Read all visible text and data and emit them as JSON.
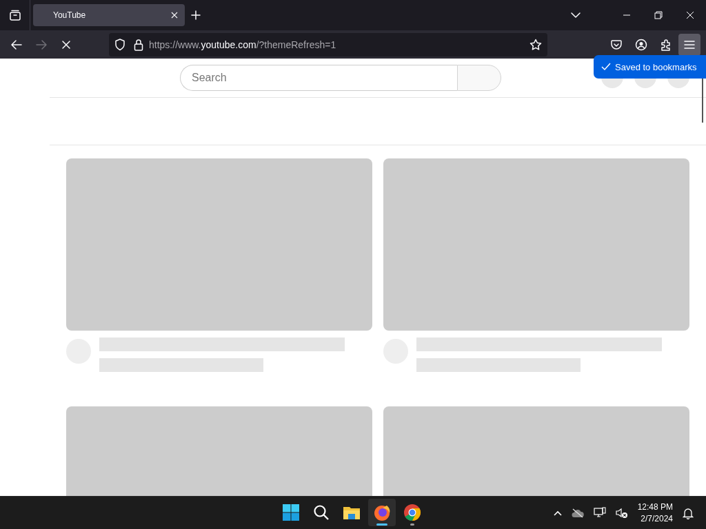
{
  "browser": {
    "tabs": [
      {
        "title": "YouTube",
        "selected": true
      }
    ],
    "loading": true,
    "forward_enabled": false,
    "menu_open": true,
    "address": {
      "prefix": "https://www.",
      "domain": "youtube.com",
      "path": "/?themeRefresh=1"
    }
  },
  "toast": {
    "text": "Saved to bookmarks"
  },
  "page": {
    "search": {
      "placeholder": "Search"
    },
    "header_buttons": [
      {
        "kind": "skeleton"
      },
      {
        "kind": "skeleton"
      },
      {
        "kind": "skeleton"
      }
    ],
    "videos": [
      {
        "kind": "skeleton"
      },
      {
        "kind": "skeleton"
      },
      {
        "kind": "thumbnail-only"
      },
      {
        "kind": "thumbnail-only"
      }
    ]
  },
  "taskbar": {
    "apps": [
      {
        "kind": "start",
        "active": false,
        "running": false
      },
      {
        "kind": "search",
        "active": false,
        "running": false
      },
      {
        "kind": "files",
        "active": false,
        "running": false
      },
      {
        "kind": "firefox",
        "active": true,
        "running": true
      },
      {
        "kind": "chrome",
        "active": false,
        "running": true
      }
    ],
    "clock": {
      "time": "12:48 PM",
      "date": "2/7/2024"
    }
  }
}
